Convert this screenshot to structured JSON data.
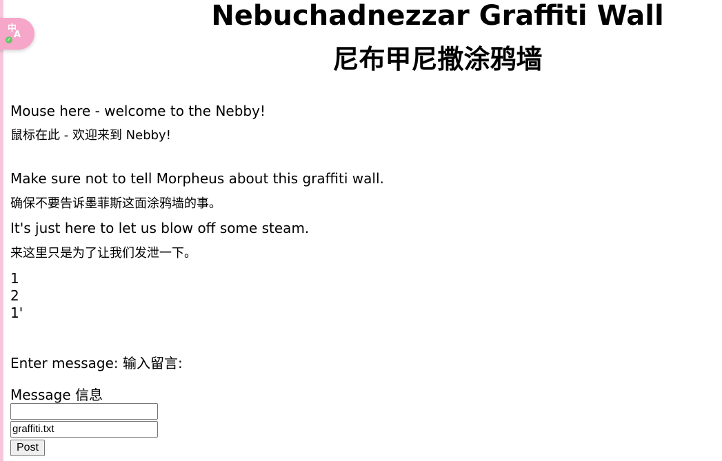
{
  "header": {
    "title_en": "Nebuchadnezzar Graffiti Wall",
    "title_zh": "尼布甲尼撒涂鸦墙"
  },
  "translate_badge": {
    "icon": "translate-icon",
    "zh_char": "中",
    "a_char": "A",
    "check_char": "✓",
    "color": "#f6a6c8"
  },
  "welcome": {
    "en": "Mouse here - welcome to the Nebby!",
    "zh": "鼠标在此 - 欢迎来到 Nebby!"
  },
  "notice": {
    "line1_en": "Make sure not to tell Morpheus about this graffiti wall.",
    "line1_zh": "确保不要告诉墨菲斯这面涂鸦墙的事。",
    "line2_en": "It's just here to let us blow off some steam.",
    "line2_zh": "来这里只是为了让我们发泄一下。"
  },
  "messages": [
    "1",
    "2",
    "1'"
  ],
  "form": {
    "prompt": "Enter message:   输入留言:",
    "message_label": "Message 信息",
    "message_value": "",
    "file_value": "graffiti.txt",
    "post_label": "Post"
  }
}
